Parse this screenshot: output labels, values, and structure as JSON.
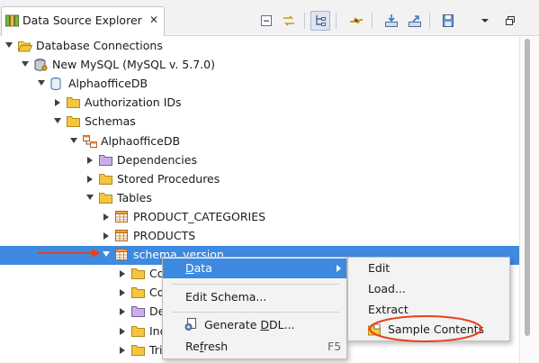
{
  "view": {
    "title": "Data Source Explorer",
    "close_glyph": "✕"
  },
  "toolbar": {
    "icons": [
      "collapse-all-icon",
      "link-with-editor-icon",
      "tree-layout-icon",
      "connect-icon",
      "import-icon",
      "export-icon",
      "save-icon",
      "view-menu-icon",
      "maximize-icon"
    ]
  },
  "tree": {
    "items": [
      {
        "label": "Database Connections",
        "level": 0,
        "expanded": true,
        "icon": "open-folder-icon"
      },
      {
        "label": "New MySQL (MySQL v. 5.7.0)",
        "level": 1,
        "expanded": true,
        "icon": "database-connection-icon"
      },
      {
        "label": "AlphaofficeDB",
        "level": 2,
        "expanded": true,
        "icon": "database-icon"
      },
      {
        "label": "Authorization IDs",
        "level": 3,
        "expanded": false,
        "icon": "folder-icon"
      },
      {
        "label": "Schemas",
        "level": 3,
        "expanded": true,
        "icon": "folder-icon"
      },
      {
        "label": "AlphaofficeDB",
        "level": 4,
        "expanded": true,
        "icon": "schema-icon"
      },
      {
        "label": "Dependencies",
        "level": 5,
        "expanded": false,
        "icon": "purple-folder-icon"
      },
      {
        "label": "Stored Procedures",
        "level": 5,
        "expanded": false,
        "icon": "folder-icon"
      },
      {
        "label": "Tables",
        "level": 5,
        "expanded": true,
        "icon": "folder-icon"
      },
      {
        "label": "PRODUCT_CATEGORIES",
        "level": 6,
        "expanded": false,
        "icon": "table-icon"
      },
      {
        "label": "PRODUCTS",
        "level": 6,
        "expanded": false,
        "icon": "table-icon"
      },
      {
        "label": "schema_version",
        "level": 6,
        "expanded": true,
        "icon": "table-icon",
        "selected": true
      },
      {
        "label": "Co",
        "level": 7,
        "expanded": false,
        "icon": "folder-icon"
      },
      {
        "label": "Co",
        "level": 7,
        "expanded": false,
        "icon": "folder-icon"
      },
      {
        "label": "De",
        "level": 7,
        "expanded": false,
        "icon": "purple-folder-icon"
      },
      {
        "label": "Ind",
        "level": 7,
        "expanded": false,
        "icon": "folder-icon"
      },
      {
        "label": "Tri",
        "level": 7,
        "expanded": false,
        "icon": "folder-icon"
      }
    ]
  },
  "context_menu": {
    "data": {
      "pre": "",
      "mn": "D",
      "post": "ata"
    },
    "edit_schema": "Edit Schema...",
    "generate_ddl": {
      "pre": "Generate ",
      "mn": "D",
      "post": "DL..."
    },
    "refresh": {
      "pre": "Re",
      "mn": "f",
      "post": "resh"
    },
    "refresh_shortcut": "F5"
  },
  "data_submenu": {
    "items": [
      "Edit",
      "Load...",
      "Extract",
      "Sample Contents"
    ]
  },
  "annotation": {
    "arrow_color": "#e8401c",
    "circle_color": "#e8401c"
  },
  "colors": {
    "selection": "#3d8ae0",
    "folder": "#f5c542",
    "purple_folder": "#b79ad8"
  }
}
